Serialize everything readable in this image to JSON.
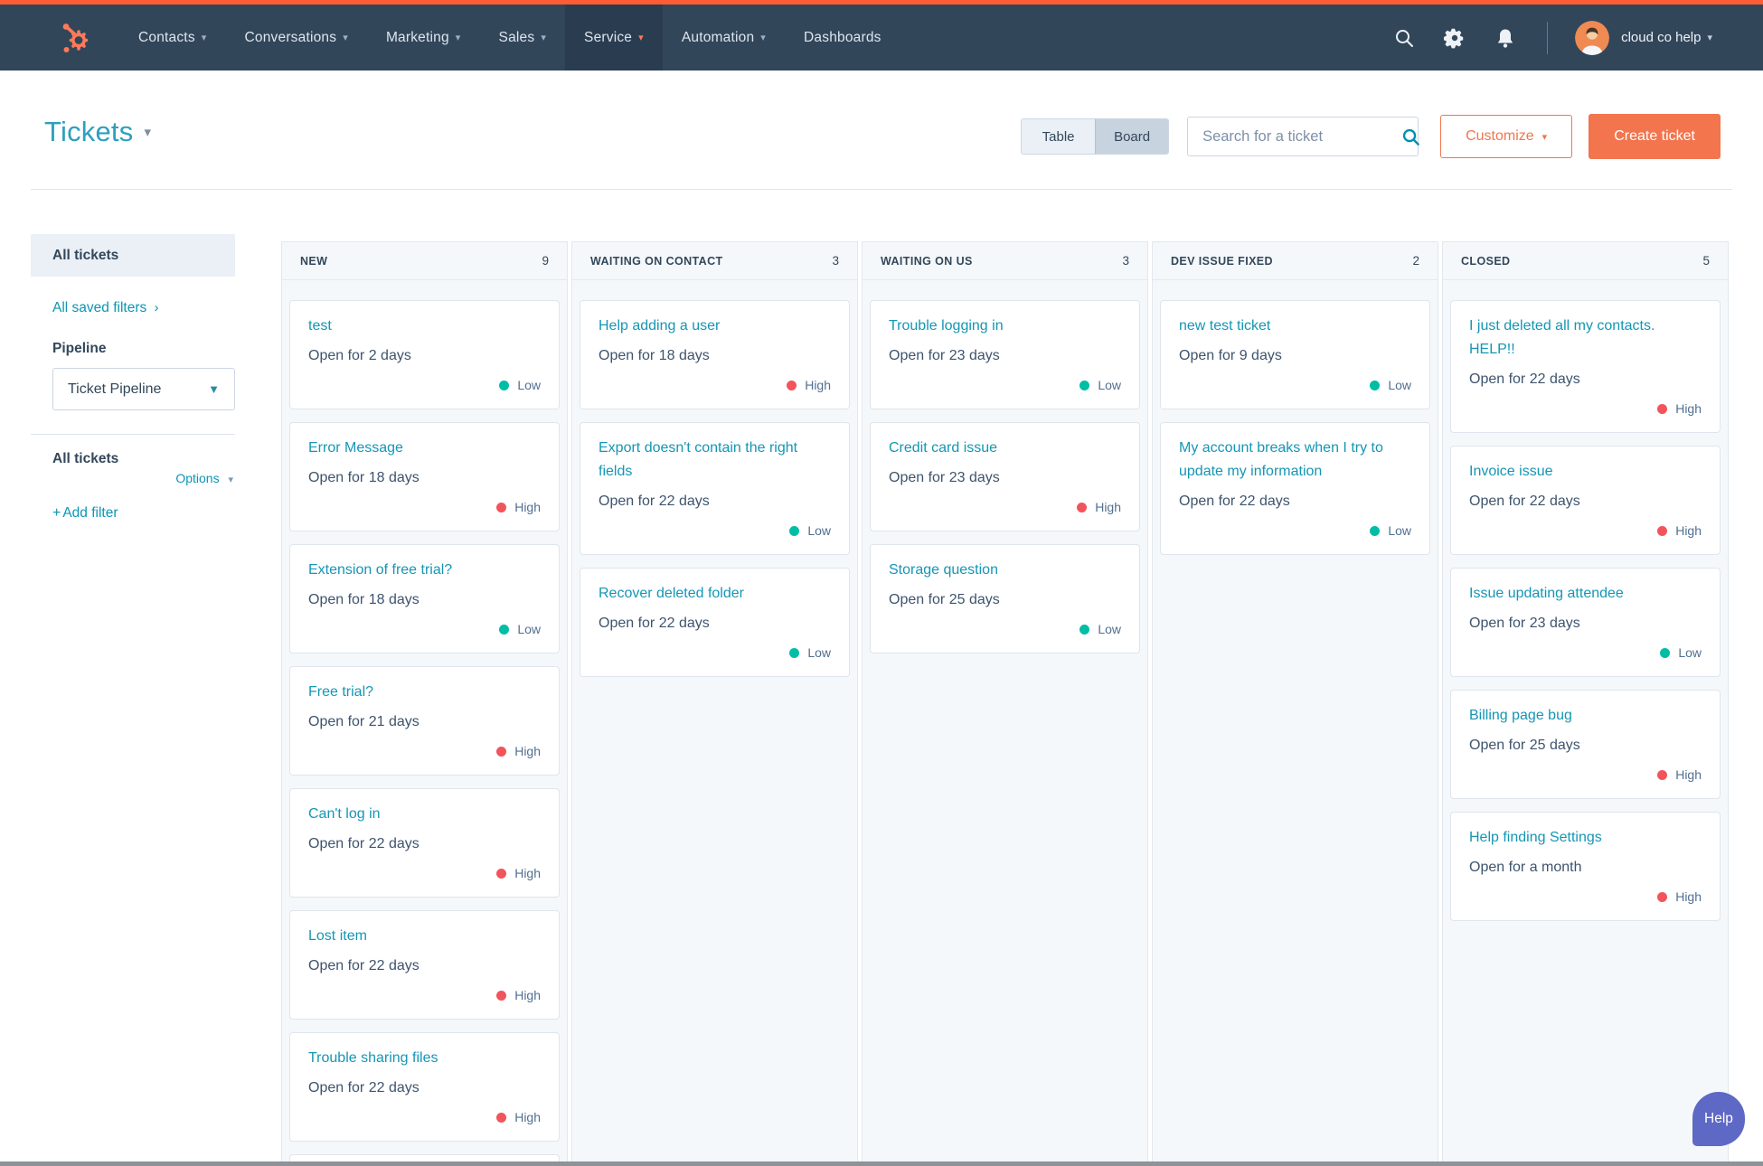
{
  "nav": {
    "items": [
      {
        "label": "Contacts",
        "caret": true,
        "active": false
      },
      {
        "label": "Conversations",
        "caret": true,
        "active": false
      },
      {
        "label": "Marketing",
        "caret": true,
        "active": false
      },
      {
        "label": "Sales",
        "caret": true,
        "active": false
      },
      {
        "label": "Service",
        "caret": true,
        "active": true
      },
      {
        "label": "Automation",
        "caret": true,
        "active": false
      },
      {
        "label": "Dashboards",
        "caret": false,
        "active": false
      }
    ],
    "account_name": "cloud co help"
  },
  "header": {
    "title": "Tickets",
    "view_toggle": {
      "options": [
        "Table",
        "Board"
      ],
      "selected": "Board"
    },
    "search_placeholder": "Search for a ticket",
    "customize_label": "Customize",
    "create_label": "Create ticket"
  },
  "sidebar": {
    "all_tickets_view": "All tickets",
    "saved_filters_link": "All saved filters",
    "pipeline_label": "Pipeline",
    "pipeline_value": "Ticket Pipeline",
    "filter_section_title": "All tickets",
    "options_label": "Options",
    "add_filter_label": "Add filter"
  },
  "board": {
    "columns": [
      {
        "name": "NEW",
        "count": 9,
        "partial_card": true,
        "cards": [
          {
            "title": "test",
            "meta": "Open for 2 days",
            "priority": "Low"
          },
          {
            "title": "Error Message",
            "meta": "Open for 18 days",
            "priority": "High"
          },
          {
            "title": "Extension of free trial?",
            "meta": "Open for 18 days",
            "priority": "Low"
          },
          {
            "title": "Free trial?",
            "meta": "Open for 21 days",
            "priority": "High"
          },
          {
            "title": "Can't log in",
            "meta": "Open for 22 days",
            "priority": "High"
          },
          {
            "title": "Lost item",
            "meta": "Open for 22 days",
            "priority": "High"
          },
          {
            "title": "Trouble sharing files",
            "meta": "Open for 22 days",
            "priority": "High"
          }
        ]
      },
      {
        "name": "WAITING ON CONTACT",
        "count": 3,
        "partial_card": false,
        "cards": [
          {
            "title": "Help adding a user",
            "meta": "Open for 18 days",
            "priority": "High"
          },
          {
            "title": "Export doesn't contain the right fields",
            "meta": "Open for 22 days",
            "priority": "Low"
          },
          {
            "title": "Recover deleted folder",
            "meta": "Open for 22 days",
            "priority": "Low"
          }
        ]
      },
      {
        "name": "WAITING ON US",
        "count": 3,
        "partial_card": false,
        "cards": [
          {
            "title": "Trouble logging in",
            "meta": "Open for 23 days",
            "priority": "Low"
          },
          {
            "title": "Credit card issue",
            "meta": "Open for 23 days",
            "priority": "High"
          },
          {
            "title": "Storage question",
            "meta": "Open for 25 days",
            "priority": "Low"
          }
        ]
      },
      {
        "name": "DEV ISSUE FIXED",
        "count": 2,
        "partial_card": false,
        "cards": [
          {
            "title": "new test ticket",
            "meta": "Open for 9 days",
            "priority": "Low"
          },
          {
            "title": "My account breaks when I try to update my information",
            "meta": "Open for 22 days",
            "priority": "Low"
          }
        ]
      },
      {
        "name": "CLOSED",
        "count": 5,
        "partial_card": false,
        "cards": [
          {
            "title": "I just deleted all my contacts. HELP!!",
            "meta": "Open for 22 days",
            "priority": "High"
          },
          {
            "title": "Invoice issue",
            "meta": "Open for 22 days",
            "priority": "High"
          },
          {
            "title": "Issue updating attendee",
            "meta": "Open for 23 days",
            "priority": "Low"
          },
          {
            "title": "Billing page bug",
            "meta": "Open for 25 days",
            "priority": "High"
          },
          {
            "title": "Help finding Settings",
            "meta": "Open for a month",
            "priority": "High"
          }
        ]
      }
    ]
  },
  "help_button_label": "Help",
  "colors": {
    "top_strip": "#fd5c35",
    "nav_bg": "#32465a",
    "accent_orange": "#f2754e",
    "link_teal": "#1596b4",
    "navy_text": "#33475b",
    "lane_bg": "#f5f8fa",
    "help_purple": "#5e68c5",
    "priority": {
      "Low": "#00bda5",
      "High": "#f2545b"
    }
  }
}
